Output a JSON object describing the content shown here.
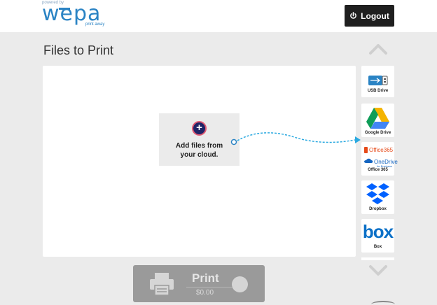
{
  "header": {
    "powered_by": "powered by",
    "logo_word": "wepa",
    "logo_tagline": "print away",
    "logout_label": "Logout"
  },
  "main": {
    "title": "Files to Print",
    "add_card_line1": "Add files from",
    "add_card_line2": "your cloud."
  },
  "sources": [
    {
      "label": "USB Drive",
      "icon": "usb-icon"
    },
    {
      "label": "Google Drive",
      "icon": "google-drive-icon"
    },
    {
      "label": "Office 365",
      "icon": "office365-icon",
      "brand_line1": "Office365",
      "brand_line2": "OneDrive",
      "brand_line3": "for Business"
    },
    {
      "label": "Dropbox",
      "icon": "dropbox-icon"
    },
    {
      "label": "Box",
      "icon": "box-icon",
      "brand": "box"
    }
  ],
  "print": {
    "label": "Print",
    "price": "$0.00"
  },
  "colors": {
    "brand_blue": "#2a83c4",
    "logout_bg": "#1f1f1f",
    "accent_cyan": "#2aa9e0",
    "plus_circle_bg": "#1f2366",
    "plus_ring": "#e05a74",
    "print_bg": "#9a9a9a"
  }
}
